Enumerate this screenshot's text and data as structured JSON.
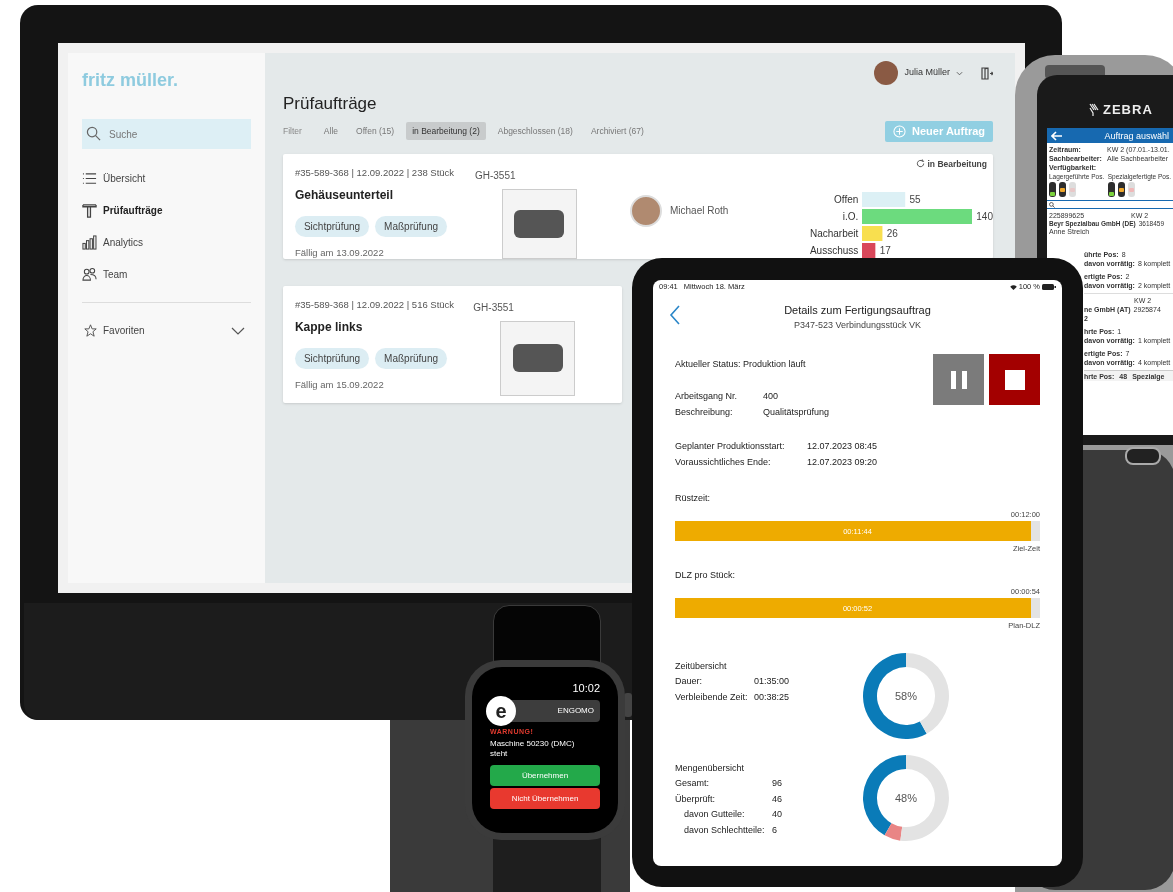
{
  "monitor": {
    "logo": "fritz müller.",
    "search": {
      "placeholder": "Suche"
    },
    "nav": [
      {
        "label": "Übersicht",
        "selected": false
      },
      {
        "label": "Prüfaufträge",
        "selected": true
      },
      {
        "label": "Analytics",
        "selected": false
      },
      {
        "label": "Team",
        "selected": false
      }
    ],
    "favorites": {
      "label": "Favoriten",
      "expanded": false
    },
    "user": {
      "name": "Julia Müller"
    },
    "title": "Prüfaufträge",
    "filter_label": "Filter",
    "filters": [
      {
        "label": "Alle",
        "selected": false
      },
      {
        "label": "Offen (15)",
        "selected": false
      },
      {
        "label": "in Bearbeitung (2)",
        "selected": true
      },
      {
        "label": "Abgeschlossen (18)",
        "selected": false
      },
      {
        "label": "Archiviert (67)",
        "selected": false
      }
    ],
    "new_button": "Neuer Auftrag",
    "orders": [
      {
        "meta": "#35-589-368 | 12.09.2022 | 238 Stück",
        "title": "Gehäuseunterteil",
        "tags": [
          "Sichtprüfung",
          "Maßprüfung"
        ],
        "due": "Fällig am 13.09.2022",
        "part_no": "GH-3551",
        "assignee": "Michael Roth",
        "status": "in Bearbeitung",
        "chart_data": {
          "type": "bar",
          "orientation": "horizontal",
          "categories": [
            "Offen",
            "i.O.",
            "Nacharbeit",
            "Ausschuss"
          ],
          "values": [
            55,
            140,
            26,
            17
          ],
          "data_labels": true
        }
      },
      {
        "meta": "#35-589-368 | 12.09.2022 | 516 Stück",
        "title": "Kappe links",
        "tags": [
          "Sichtprüfung",
          "Maßprüfung"
        ],
        "due": "Fällig am 15.09.2022",
        "part_no": "GH-3551"
      }
    ]
  },
  "scanner": {
    "brand": "ZEBRA",
    "title": "Auftrag auswähl",
    "fields": [
      {
        "label": "Zeitraum:",
        "value": "KW 2 (07.01.-13.01."
      },
      {
        "label": "Sachbearbeiter:",
        "value": "Alle Sachbearbeiter"
      }
    ],
    "availability": {
      "label": "Verfügbarkeit:",
      "groups": [
        {
          "label": "Lagergeführte Pos.",
          "lights": [
            {
              "color": "#7bd23c"
            },
            {
              "color": "#f0a72a"
            },
            {
              "color": "#e8c8c8"
            }
          ]
        },
        {
          "label": "Spezialgefertigte Pos.",
          "lights": [
            {
              "color": "#7bd23c"
            },
            {
              "color": "#f0a72a"
            },
            {
              "color": "#f0b8b8"
            }
          ]
        }
      ]
    },
    "record": {
      "number": "225899625",
      "week": "KW 2",
      "company": "Beyr Spezialbau GmbH (DE)",
      "code": "3618459",
      "contact": "Anne Streich"
    },
    "lower_cards": [
      {
        "groups": [
          [
            {
              "label": "ührte Pos:",
              "value": "8"
            },
            {
              "label": "davon vorrätig:",
              "value": "8 komplett"
            }
          ],
          [
            {
              "label": "ertigte Pos:",
              "value": "2"
            },
            {
              "label": "davon vorrätig:",
              "value": "2 komplett"
            }
          ]
        ]
      },
      {
        "groups": [
          [
            {
              "value": "KW 2"
            },
            {
              "label": "ne GmbH (AT)",
              "value": "2925874"
            },
            {
              "label": "2"
            }
          ],
          [
            {
              "label": "hrte Pos:",
              "value": "1"
            },
            {
              "label": "davon vorrätig:",
              "value": "1 komplett"
            }
          ],
          [
            {
              "label": "ertigte Pos:",
              "value": "7"
            },
            {
              "label": "davon vorrätig:",
              "value": "4 komplett"
            }
          ]
        ]
      }
    ],
    "footer": [
      "hrte Pos:",
      "48",
      "Spezialge"
    ]
  },
  "tablet": {
    "status_bar": {
      "time": "09:41",
      "date": "Mittwoch 18. März",
      "battery": "100 %"
    },
    "title": "Details zum Fertigungsauftrag",
    "subtitle": "P347-523 Verbindungsstück VK",
    "status": "Aktueller Status: Produktion läuft",
    "info_groups": [
      [
        {
          "label": "Arbeitsgang Nr.",
          "value": "400"
        },
        {
          "label": "Beschreibung:",
          "value": "Qualitätsprüfung"
        }
      ],
      [
        {
          "label": "Geplanter Produktionsstart:",
          "value": "12.07.2023 08:45"
        },
        {
          "label": "Voraussichtliches Ende:",
          "value": "12.07.2023 09:20"
        }
      ]
    ],
    "progress": [
      {
        "label": "Rüstzeit:",
        "target": "00:12:00",
        "reading": "00:11:44",
        "level": 0.975,
        "caption": "Ziel-Zeit"
      },
      {
        "label": "DLZ pro Stück:",
        "target": "00:00:54",
        "reading": "00:00:52",
        "level": 0.975,
        "caption": "Plan-DLZ"
      }
    ],
    "summaries": [
      {
        "title": "Zeitübersicht",
        "rows": [
          {
            "label": "Dauer:",
            "value": "01:35:00",
            "indented": false
          },
          {
            "label": "Verbleibende Zeit:",
            "value": "00:38:25",
            "indented": false
          }
        ],
        "reading": "58%",
        "chart_data": {
          "type": "donut",
          "values": [
            58,
            42
          ]
        }
      },
      {
        "title": "Mengenübersicht",
        "rows": [
          {
            "label": "Gesamt:",
            "value": "96",
            "indented": false
          },
          {
            "label": "Überprüft:",
            "value": "46",
            "indented": false
          },
          {
            "label": "davon Gutteile:",
            "value": "40",
            "indented": true
          },
          {
            "label": "davon Schlechtteile:",
            "value": "6",
            "indented": true
          }
        ],
        "reading": "48%",
        "chart_data": {
          "type": "donut",
          "values": [
            41.7,
            6.2,
            52.1
          ]
        }
      }
    ]
  },
  "watch": {
    "time": "10:02",
    "logo_letter": "e",
    "app": "ENGOMO",
    "warning": "WARNUNG!",
    "message": "Maschine 50230 (DMC) steht",
    "buttons": [
      {
        "label": "Übernehmen",
        "kind": "accept"
      },
      {
        "label": "Nicht Übernehmen",
        "kind": "decline"
      }
    ]
  }
}
